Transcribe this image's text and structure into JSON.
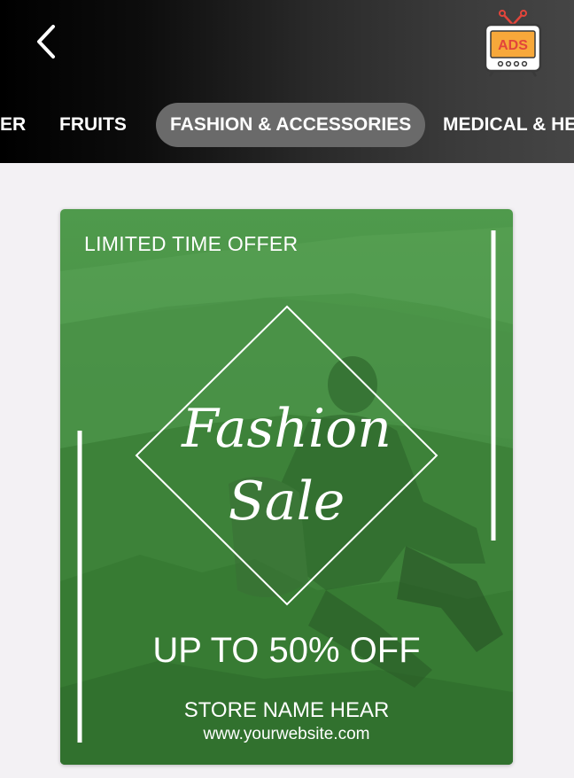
{
  "header": {
    "back_icon": "chevron-left-icon",
    "ads_icon_label": "ADS"
  },
  "tabs": [
    {
      "label": "ER",
      "active": false
    },
    {
      "label": "FRUITS",
      "active": false
    },
    {
      "label": "FASHION & ACCESSORIES",
      "active": true
    },
    {
      "label": "MEDICAL & HE",
      "active": false
    }
  ],
  "ad": {
    "offer": "LIMITED TIME OFFER",
    "title_line1": "Fashion",
    "title_line2": "Sale",
    "discount": "UP TO 50% OFF",
    "store": "STORE NAME HEAR",
    "website": "www.yourwebsite.com"
  },
  "colors": {
    "overlay_green": "#3f8a3c",
    "tab_active_bg": "#6a6a6a",
    "ads_screen": "#f7a83a",
    "ads_antenna": "#e2453b"
  }
}
